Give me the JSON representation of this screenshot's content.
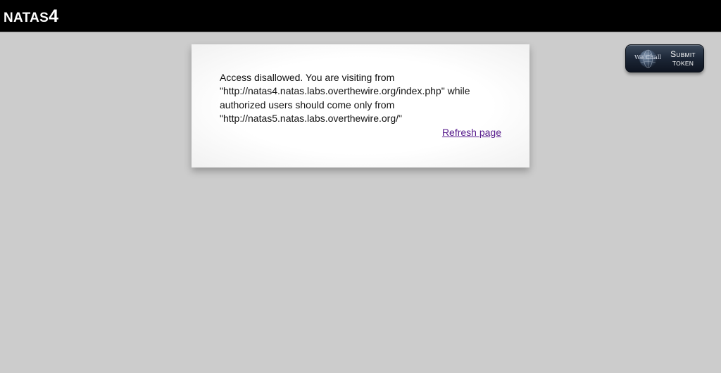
{
  "header": {
    "logo_name": "NATAS",
    "logo_number": "4"
  },
  "content": {
    "message": "Access disallowed. You are visiting from \"http://natas4.natas.labs.overthewire.org/index.php\" while authorized users should come only from \"http://natas5.natas.labs.overthewire.org/\"",
    "refresh_link": "Refresh page"
  },
  "submit_token": {
    "brand": "We Chall",
    "line1": "Submit",
    "line2": "Token",
    "icon": "globe-icon"
  },
  "colors": {
    "header_bg": "#000000",
    "page_bg": "#cccccc",
    "panel_bg": "#ffffff",
    "link": "#551a8b",
    "button_bg": "#1c2636"
  }
}
